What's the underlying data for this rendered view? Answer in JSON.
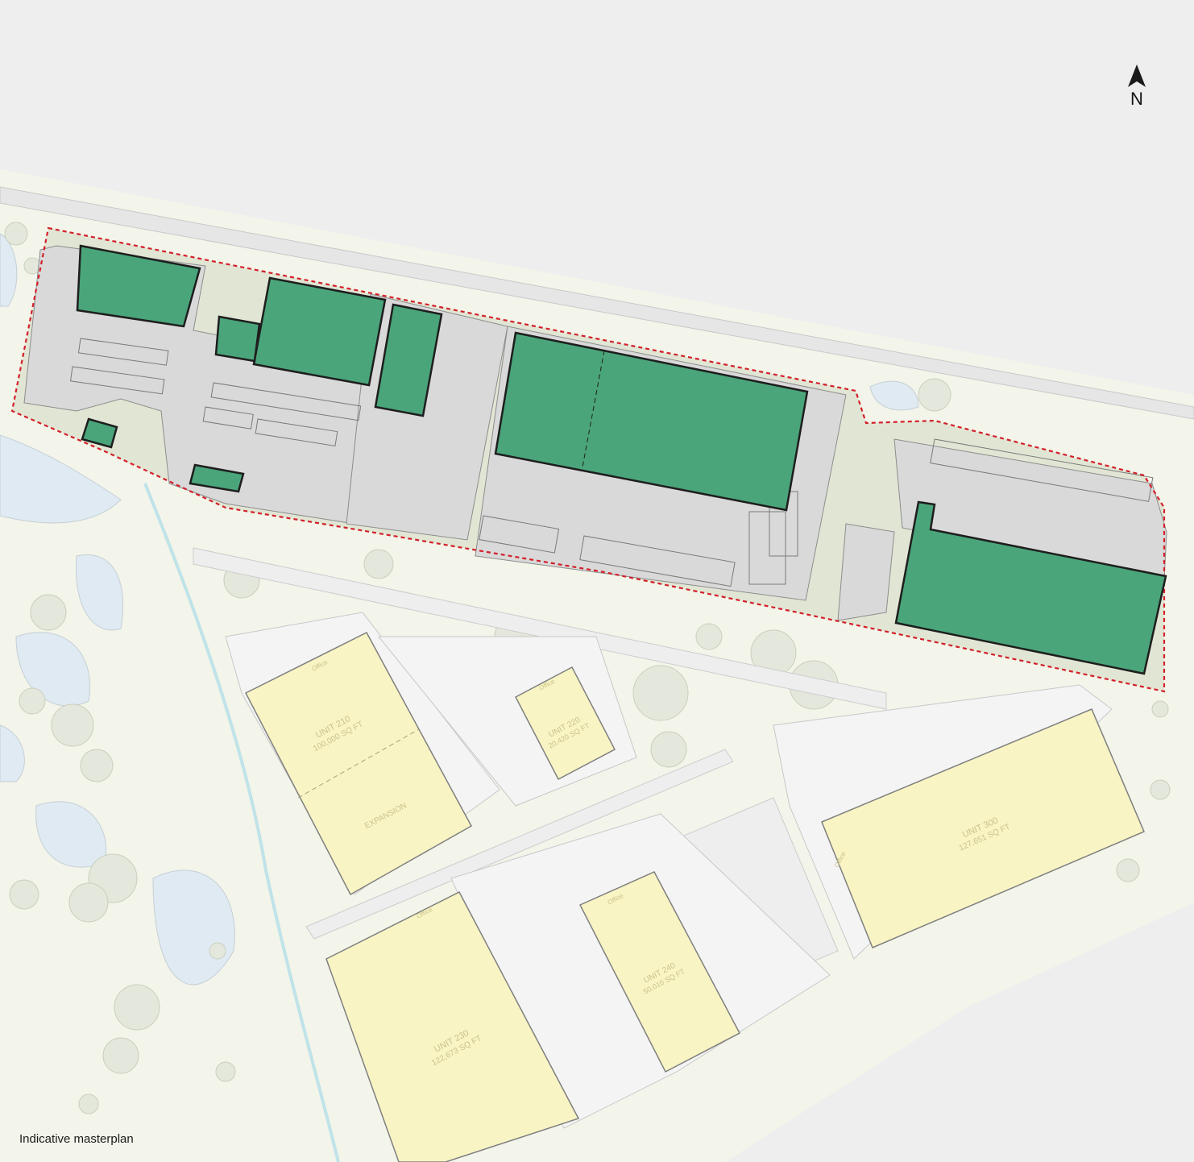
{
  "caption": "Indicative masterplan",
  "north_arrow": {
    "letter": "N",
    "icon": "north-arrow-icon"
  },
  "units": [
    {
      "id": "unit-210",
      "name": "UNIT 210",
      "area": "100,000 SQ FT",
      "extra": "EXPANSION",
      "office": "Office"
    },
    {
      "id": "unit-220",
      "name": "UNIT 220",
      "area": "20,420 SQ FT",
      "office": "Office"
    },
    {
      "id": "unit-230",
      "name": "UNIT 230",
      "area": "122,673 SQ FT",
      "office": "Office"
    },
    {
      "id": "unit-240",
      "name": "UNIT 240",
      "area": "50,010 SQ FT",
      "office": "Office"
    },
    {
      "id": "unit-300",
      "name": "UNIT 300",
      "area": "127,651 SQ FT",
      "office": "Office"
    }
  ],
  "colors": {
    "background": "#eeeeee",
    "landscape": "#f3f4ea",
    "site_boundary": "#d3202a",
    "building_existing": "#4aa57a",
    "building_proposed": "#f8f4c4",
    "hardstanding": "#d9d9d9",
    "water": "#dfeaf2"
  }
}
